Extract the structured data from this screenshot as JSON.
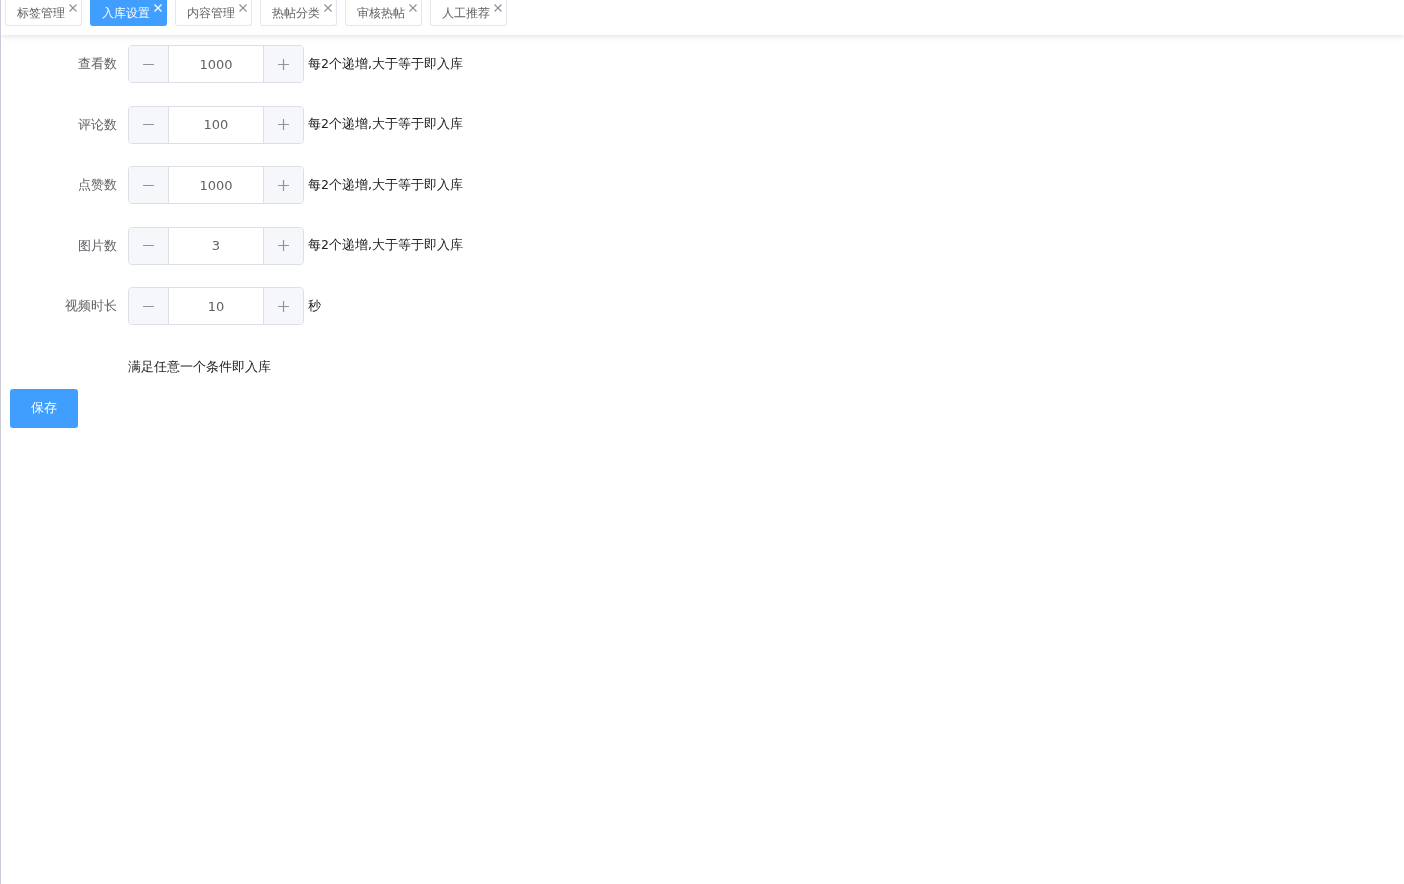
{
  "tabs": [
    {
      "label": "标签管理",
      "selected": false
    },
    {
      "label": "入库设置",
      "selected": true
    },
    {
      "label": "内容管理",
      "selected": false
    },
    {
      "label": "热帖分类",
      "selected": false
    },
    {
      "label": "审核热帖",
      "selected": false
    },
    {
      "label": "人工推荐",
      "selected": false
    }
  ],
  "form": {
    "fields": [
      {
        "label": "查看数",
        "value": "1000",
        "hint": "每2个递增,大于等于即入库"
      },
      {
        "label": "评论数",
        "value": "100",
        "hint": "每2个递增,大于等于即入库"
      },
      {
        "label": "点赞数",
        "value": "1000",
        "hint": "每2个递增,大于等于即入库"
      },
      {
        "label": "图片数",
        "value": "3",
        "hint": "每2个递增,大于等于即入库"
      },
      {
        "label": "视频时长",
        "value": "10",
        "hint": "秒"
      }
    ],
    "note": "满足任意一个条件即入库",
    "save_button": "保存"
  }
}
